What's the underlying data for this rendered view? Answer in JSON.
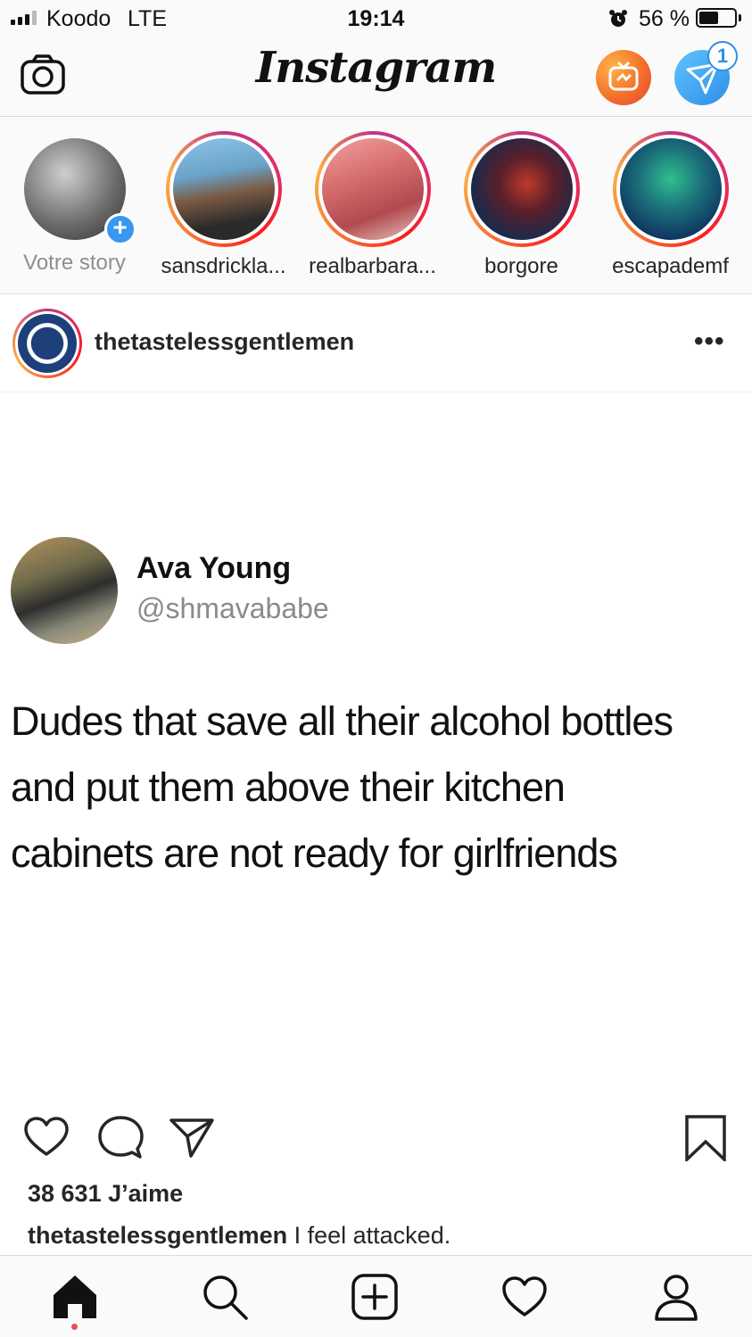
{
  "status_bar": {
    "carrier": "Koodo",
    "network": "LTE",
    "time": "19:14",
    "battery_percent": "56 %",
    "battery_level": 0.56,
    "icons": [
      "signal-icon",
      "alarm-icon",
      "battery-icon"
    ]
  },
  "header": {
    "logo": "Instagram",
    "dm_badge_count": "1",
    "icons": [
      "camera-icon",
      "igtv-icon",
      "direct-message-icon"
    ],
    "colors": {
      "igtv": "#f26b2a",
      "direct": "#2f8ee6"
    }
  },
  "stories": [
    {
      "label": "Votre story",
      "own": true
    },
    {
      "label": "sansdrickla..."
    },
    {
      "label": "realbarbara..."
    },
    {
      "label": "borgore"
    },
    {
      "label": "escapademf"
    }
  ],
  "post": {
    "username": "thetastelessgentlemen",
    "tweet": {
      "name": "Ava Young",
      "handle": "@shmavababe",
      "lines": [
        "Dudes that save all their alcohol bottles",
        "and put them above their kitchen",
        "cabinets are not ready for girlfriends"
      ]
    },
    "likes": "38 631 J’aime",
    "caption_user": "thetastelessgentlemen",
    "caption_text": " I feel attacked."
  },
  "bottom_nav": {
    "icons": [
      "home-icon",
      "search-icon",
      "add-post-icon",
      "activity-heart-icon",
      "profile-icon"
    ],
    "accent_dot": "#ed4956"
  }
}
